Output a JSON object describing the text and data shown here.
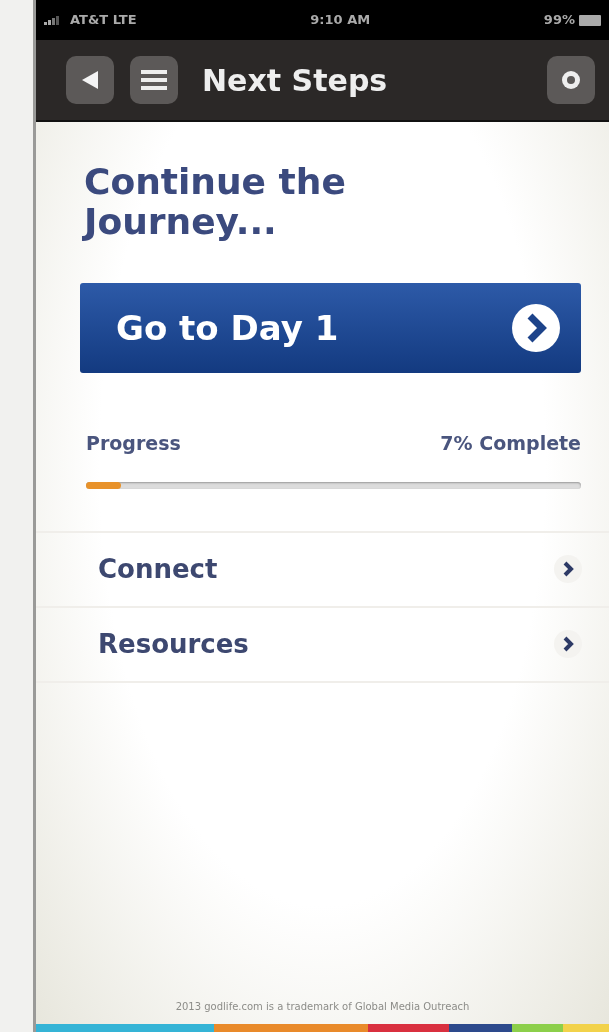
{
  "status_bar": {
    "carrier": "AT&T LTE",
    "time": "9:10 AM",
    "battery": "99%"
  },
  "nav_bar": {
    "title": "Next Steps"
  },
  "heading": "Continue the Journey...",
  "primary_button": {
    "label": "Go to Day 1"
  },
  "progress": {
    "label": "Progress",
    "reading": "7% Complete",
    "level": 0.07
  },
  "menu_items": [
    {
      "label": "Connect"
    },
    {
      "label": "Resources"
    }
  ],
  "footer": "2013 godlife.com is a trademark of Global Media Outreach"
}
